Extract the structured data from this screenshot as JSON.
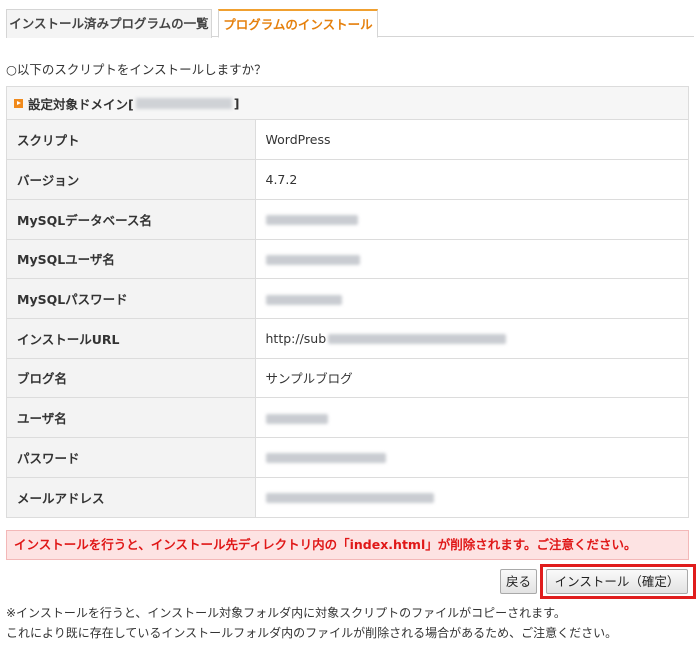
{
  "tabs": {
    "installed_label": "インストール済みプログラムの一覧",
    "install_label": "プログラムのインストール"
  },
  "question": "○以下のスクリプトをインストールしますか？",
  "panel": {
    "header_prefix": "設定対象ドメイン[",
    "header_suffix": "]"
  },
  "rows": [
    {
      "label": "スクリプト",
      "value": "WordPress"
    },
    {
      "label": "バージョン",
      "value": "4.7.2"
    },
    {
      "label": "MySQLデータベース名",
      "value": ""
    },
    {
      "label": "MySQLユーザ名",
      "value": ""
    },
    {
      "label": "MySQLパスワード",
      "value": ""
    },
    {
      "label": "インストールURL",
      "value": "http://sub"
    },
    {
      "label": "ブログ名",
      "value": "サンプルブログ"
    },
    {
      "label": "ユーザ名",
      "value": ""
    },
    {
      "label": "パスワード",
      "value": ""
    },
    {
      "label": "メールアドレス",
      "value": ""
    }
  ],
  "warning": "インストールを行うと、インストール先ディレクトリ内の「index.html」が削除されます。ご注意ください。",
  "buttons": {
    "back_label": "戻る",
    "confirm_label": "インストール（確定）"
  },
  "notes": {
    "line1": "※インストールを行うと、インストール対象フォルダ内に対象スクリプトのファイルがコピーされます。",
    "line2": "これにより既に存在しているインストールフォルダ内のファイルが削除される場合があるため、ご注意ください。"
  },
  "colors": {
    "accent": "#e5800d",
    "warning_text": "#e01818",
    "warning_bg": "#fde3e3",
    "highlight": "#e01d1d"
  }
}
